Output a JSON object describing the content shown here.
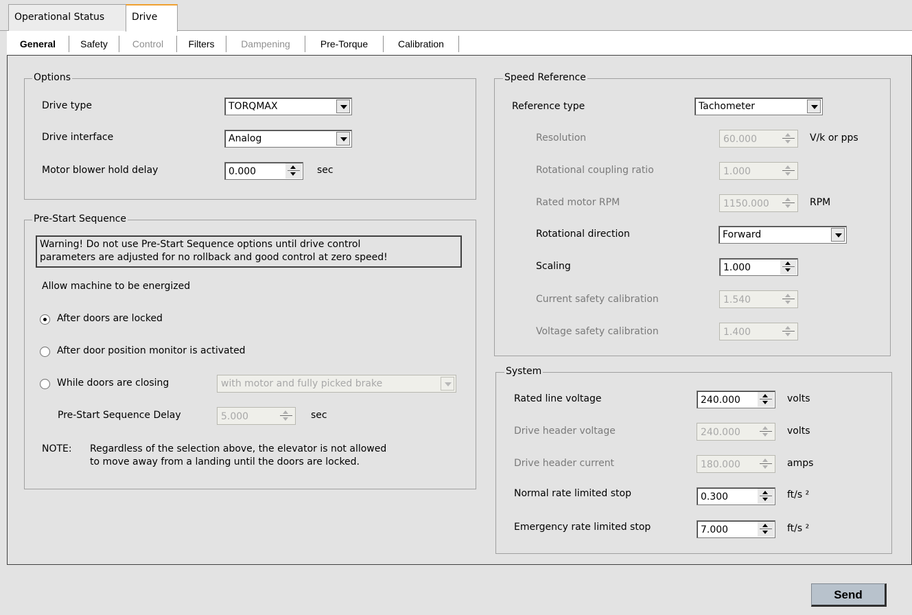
{
  "top_tabs": [
    "Operational Status",
    "Drive"
  ],
  "sub_tabs": [
    {
      "label": "General",
      "state": "active"
    },
    {
      "label": "Safety",
      "state": "normal"
    },
    {
      "label": "Control",
      "state": "disabled"
    },
    {
      "label": "Filters",
      "state": "normal"
    },
    {
      "label": "Dampening",
      "state": "disabled"
    },
    {
      "label": "Pre-Torque",
      "state": "normal"
    },
    {
      "label": "Calibration",
      "state": "normal"
    }
  ],
  "options": {
    "title": "Options",
    "drive_type_label": "Drive type",
    "drive_type_value": "TORQMAX",
    "drive_interface_label": "Drive interface",
    "drive_interface_value": "Analog",
    "blower_label": "Motor blower hold delay",
    "blower_value": "0.000",
    "blower_unit": "sec"
  },
  "prestart": {
    "title": "Pre-Start Sequence",
    "warning_line1": "Warning! Do not use Pre-Start Sequence options until drive control",
    "warning_line2": "parameters are adjusted for no rollback and good control at zero speed!",
    "allow_label": "Allow machine to be energized",
    "radio1": "After doors are locked",
    "radio2": "After door position monitor is activated",
    "radio3": "While doors are closing",
    "closing_combo_value": "with motor and fully picked brake",
    "delay_label": "Pre-Start Sequence Delay",
    "delay_value": "5.000",
    "delay_unit": "sec",
    "note_prefix": "NOTE:",
    "note_line1": "Regardless of the selection above, the elevator is not allowed",
    "note_line2": "to move away from a landing until the doors are locked."
  },
  "speed_ref": {
    "title": "Speed Reference",
    "ref_type_label": "Reference type",
    "ref_type_value": "Tachometer",
    "resolution_label": "Resolution",
    "resolution_value": "60.000",
    "resolution_unit": "V/k or pps",
    "coupling_label": "Rotational coupling ratio",
    "coupling_value": "1.000",
    "rpm_label": "Rated motor RPM",
    "rpm_value": "1150.000",
    "rpm_unit": "RPM",
    "direction_label": "Rotational direction",
    "direction_value": "Forward",
    "scaling_label": "Scaling",
    "scaling_value": "1.000",
    "current_cal_label": "Current safety calibration",
    "current_cal_value": "1.540",
    "voltage_cal_label": "Voltage safety calibration",
    "voltage_cal_value": "1.400"
  },
  "system": {
    "title": "System",
    "line_voltage_label": "Rated line voltage",
    "line_voltage_value": "240.000",
    "line_voltage_unit": "volts",
    "header_voltage_label": "Drive header voltage",
    "header_voltage_value": "240.000",
    "header_voltage_unit": "volts",
    "header_current_label": "Drive header current",
    "header_current_value": "180.000",
    "header_current_unit": "amps",
    "normal_stop_label": "Normal rate limited stop",
    "normal_stop_value": "0.300",
    "normal_stop_unit": "ft/s ²",
    "emergency_stop_label": "Emergency rate limited stop",
    "emergency_stop_value": "7.000",
    "emergency_stop_unit": "ft/s ²"
  },
  "send_label": "Send"
}
